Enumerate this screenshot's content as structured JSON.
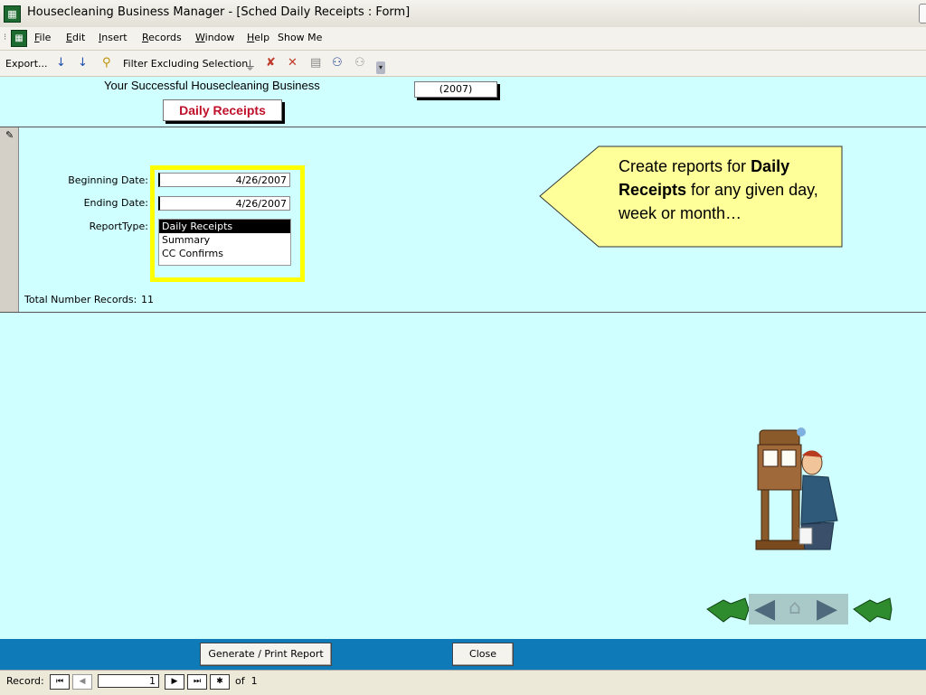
{
  "window": {
    "title": "Housecleaning Business Manager - [Sched Daily Receipts : Form]",
    "icon": "access-form-icon"
  },
  "menu": {
    "items": [
      {
        "label": "File",
        "key": "F",
        "rest": "ile"
      },
      {
        "label": "Edit",
        "key": "E",
        "rest": "dit"
      },
      {
        "label": "Insert",
        "key": "I",
        "rest": "nsert"
      },
      {
        "label": "Records",
        "key": "R",
        "rest": "ecords"
      },
      {
        "label": "Window",
        "key": "W",
        "rest": "indow"
      },
      {
        "label": "Help",
        "key": "H",
        "rest": "elp"
      },
      {
        "label": "Show Me",
        "key": "",
        "rest": "Show Me"
      }
    ]
  },
  "toolbar": {
    "export_label": "Export...",
    "filter_label": "Filter Excluding Selection",
    "icons": [
      "sort-ascending-icon",
      "sort-descending-icon",
      "filter-by-selection-icon",
      "apply-filter-icon",
      "remove-filter-icon",
      "delete-record-icon",
      "properties-icon",
      "find-icon",
      "replace-icon"
    ]
  },
  "header": {
    "subtitle": "Your Successful Housecleaning Business",
    "year": "(2007)",
    "form_title": "Daily Receipts"
  },
  "form": {
    "beginning_date_label": "Beginning Date:",
    "beginning_date": "4/26/2007",
    "ending_date_label": "Ending Date:",
    "ending_date": "4/26/2007",
    "report_type_label": "ReportType:",
    "report_types": [
      "Daily Receipts",
      "Summary",
      "CC Confirms"
    ],
    "selected_report_type": "Daily Receipts",
    "total_records_label": "Total Number Records:",
    "total_records": "11"
  },
  "callout": {
    "text_before": "Create reports for ",
    "text_bold": "Daily Receipts",
    "text_after": " for any given day, week or month…",
    "fill_color": "#ffff99"
  },
  "footer": {
    "generate_label": "Generate / Print Report",
    "close_label": "Close",
    "bar_color": "#0e7ab8"
  },
  "record_nav": {
    "label": "Record:",
    "current": "1",
    "of_text": "of  1"
  },
  "colors": {
    "form_background": "#cfffff",
    "highlight": "#ffff00"
  }
}
